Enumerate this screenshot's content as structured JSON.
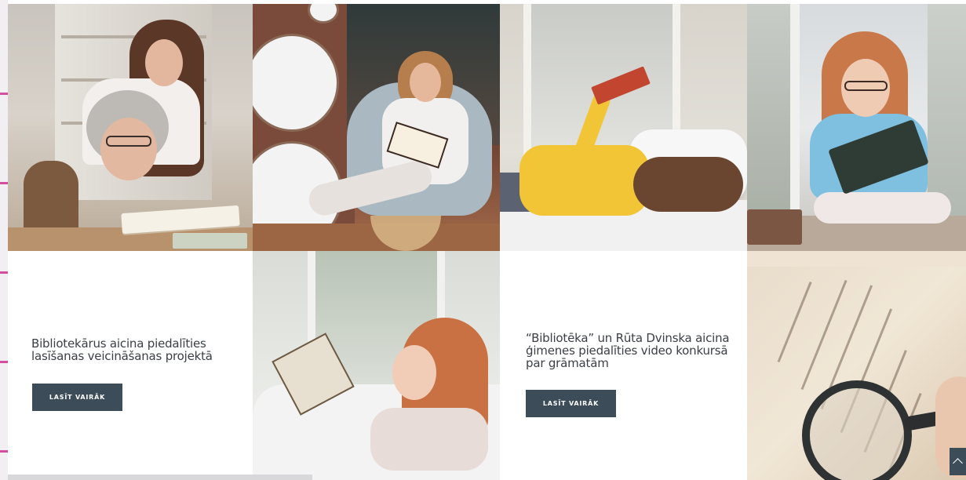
{
  "cards": [
    {
      "title_line1": "Bibliotekārus aicina piedalīties",
      "title_line2": "lasīšanas veicināšanas projektā",
      "button_label": "LASĪT VAIRĀK"
    },
    {
      "title_line1": "“Bibliotēka” un Rūta Dvinska aicina",
      "title_line2": "ģimenes piedalīties video konkursā",
      "title_line3": "par grāmatām",
      "button_label": "LASĪT VAIRĀK"
    }
  ],
  "photos": [
    "grandmother-and-girl-reading-photo",
    "girl-in-armchair-reading-photo",
    "girl-reading-on-bed-photo",
    "girl-reading-on-windowsill-photo",
    "child-reading-in-bed-photo",
    "magnifying-glass-on-book-photo"
  ],
  "colors": {
    "button_bg": "#3c4d59",
    "button_text": "#ffffff",
    "title_text": "#3b3f45",
    "edge_accent": "#d24fa0"
  },
  "icons": {
    "scroll_top": "chevron-up-icon"
  }
}
